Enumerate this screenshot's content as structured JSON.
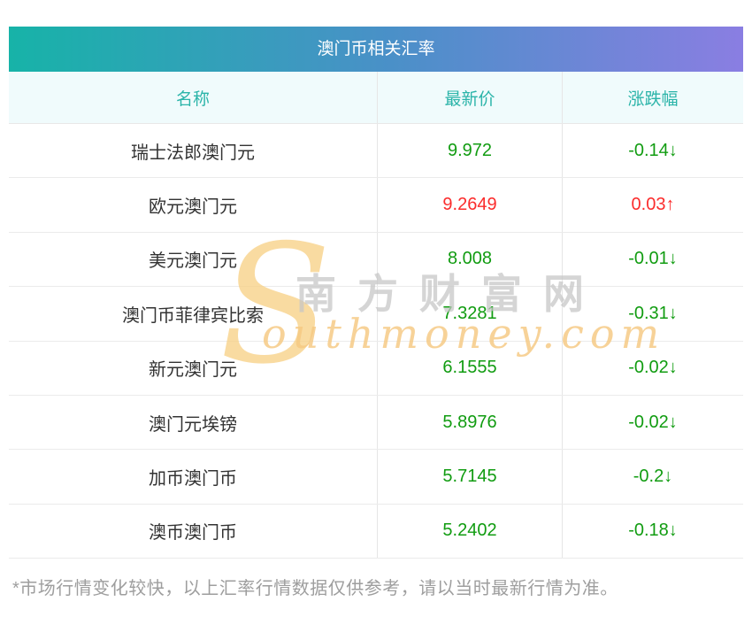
{
  "chart_data": {
    "type": "table",
    "title": "澳门币相关汇率",
    "columns": [
      "名称",
      "最新价",
      "涨跌幅"
    ],
    "rows": [
      {
        "name": "瑞士法郎澳门元",
        "price": "9.972",
        "change": "-0.14↓",
        "trend": "down"
      },
      {
        "name": "欧元澳门元",
        "price": "9.2649",
        "change": "0.03↑",
        "trend": "up"
      },
      {
        "name": "美元澳门元",
        "price": "8.008",
        "change": "-0.01↓",
        "trend": "down"
      },
      {
        "name": "澳门币菲律宾比索",
        "price": "7.3281",
        "change": "-0.31↓",
        "trend": "down"
      },
      {
        "name": "新元澳门元",
        "price": "6.1555",
        "change": "-0.02↓",
        "trend": "down"
      },
      {
        "name": "澳门元埃镑",
        "price": "5.8976",
        "change": "-0.02↓",
        "trend": "down"
      },
      {
        "name": "加币澳门币",
        "price": "5.7145",
        "change": "-0.2↓",
        "trend": "down"
      },
      {
        "name": "澳币澳门币",
        "price": "5.2402",
        "change": "-0.18↓",
        "trend": "down"
      }
    ],
    "layout": {
      "grid": "row-and-column-separators",
      "header_align": "center",
      "cell_align": "center"
    }
  },
  "footnote": "*市场行情变化较快，以上汇率行情数据仅供参考，请以当时最新行情为准。",
  "watermark": {
    "initial": "S",
    "cn": "南方财富网",
    "en": "outhmoney.com"
  },
  "colors": {
    "header_gradient_start": "#17b3a8",
    "header_gradient_mid": "#4a90c8",
    "header_gradient_end": "#8a7ee2",
    "header_row_bg": "#f0fbfc",
    "accent_teal": "#2bb4a9",
    "value_up_red": "#fb2c2c",
    "value_down_green": "#119c11",
    "name_text": "#333333",
    "footnote_gray": "#9e9e9e",
    "watermark_gold": "#f6c982",
    "watermark_gray": "#c6c6c6"
  }
}
